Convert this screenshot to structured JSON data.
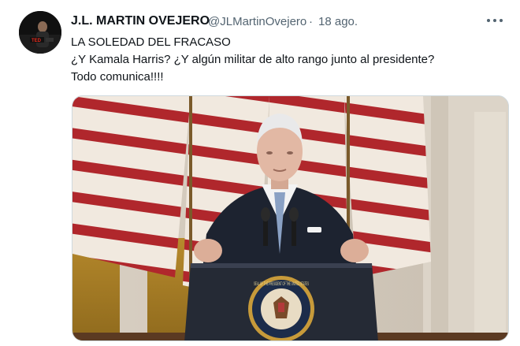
{
  "author": {
    "name": "J.L. MARTIN OVEJERO",
    "handle": "@JLMartinOvejero",
    "separator": "·",
    "date": "18 ago.",
    "avatar_badge": "TED"
  },
  "tweet": {
    "lines": [
      "LA SOLEDAD DEL FRACASO",
      "¿Y Kamala Harris? ¿Y algún militar de alto rango junto al presidente?",
      "Todo comunica!!!!"
    ]
  },
  "media": {
    "seal_text": "SEAL OF THE PRESIDENT OF THE UNITED STATES"
  },
  "icons": {
    "more": "more-horizontal-icon"
  },
  "colors": {
    "text_primary": "#0f1419",
    "text_secondary": "#536471",
    "border": "#cfd9de"
  }
}
